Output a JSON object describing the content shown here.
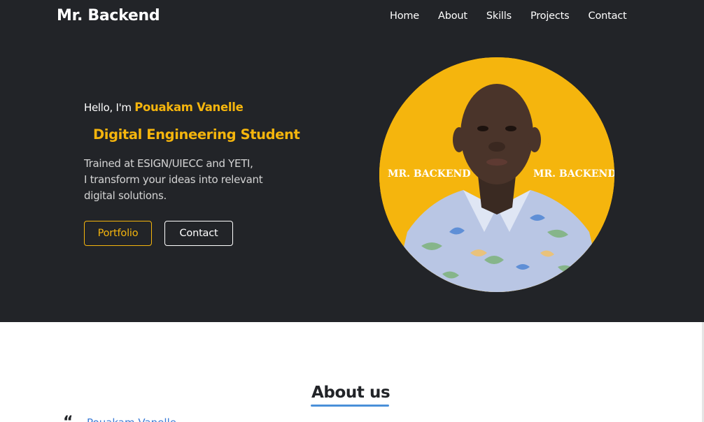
{
  "brand": "Mr. Backend",
  "nav": [
    "Home",
    "About",
    "Skills",
    "Projects",
    "Contact"
  ],
  "hero": {
    "greeting": "Hello, I'm",
    "name": "Pouakam Vanelle",
    "role": "Digital Engineering Student",
    "description": [
      "Trained at ESIGN/UIECC and YETI,",
      "I transform your ideas into relevant",
      "digital solutions."
    ],
    "buttons": {
      "portfolio": "Portfolio",
      "contact": "Contact"
    },
    "photo_watermark": "MR. BACKEND"
  },
  "about": {
    "title": "About us",
    "quote_mark": "“",
    "intro_name": "Pouakam Vanelle",
    "intro_rest": ""
  },
  "colors": {
    "accent": "#f5b50d",
    "dark_bg": "#222428",
    "link": "#3a7bd5"
  }
}
